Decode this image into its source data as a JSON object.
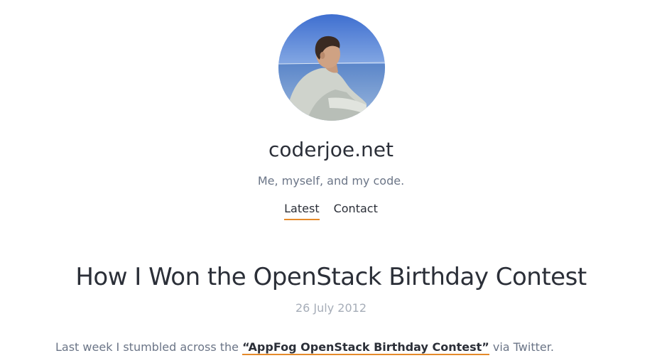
{
  "header": {
    "avatar_icon": "profile-photo",
    "site_title": "coderjoe.net",
    "tagline": "Me, myself, and my code."
  },
  "nav": {
    "items": [
      {
        "label": "Latest",
        "active": true
      },
      {
        "label": "Contact",
        "active": false
      }
    ]
  },
  "post": {
    "title": "How I Won the OpenStack Birthday Contest",
    "date": "26 July 2012",
    "body_before": "Last week I stumbled across the ",
    "link_text": "“AppFog OpenStack Birthday Contest”",
    "body_after": " via Twitter."
  },
  "colors": {
    "accent": "#e58a2a",
    "text": "#2b2f38",
    "muted": "#6b7587",
    "date": "#a6adb8"
  }
}
